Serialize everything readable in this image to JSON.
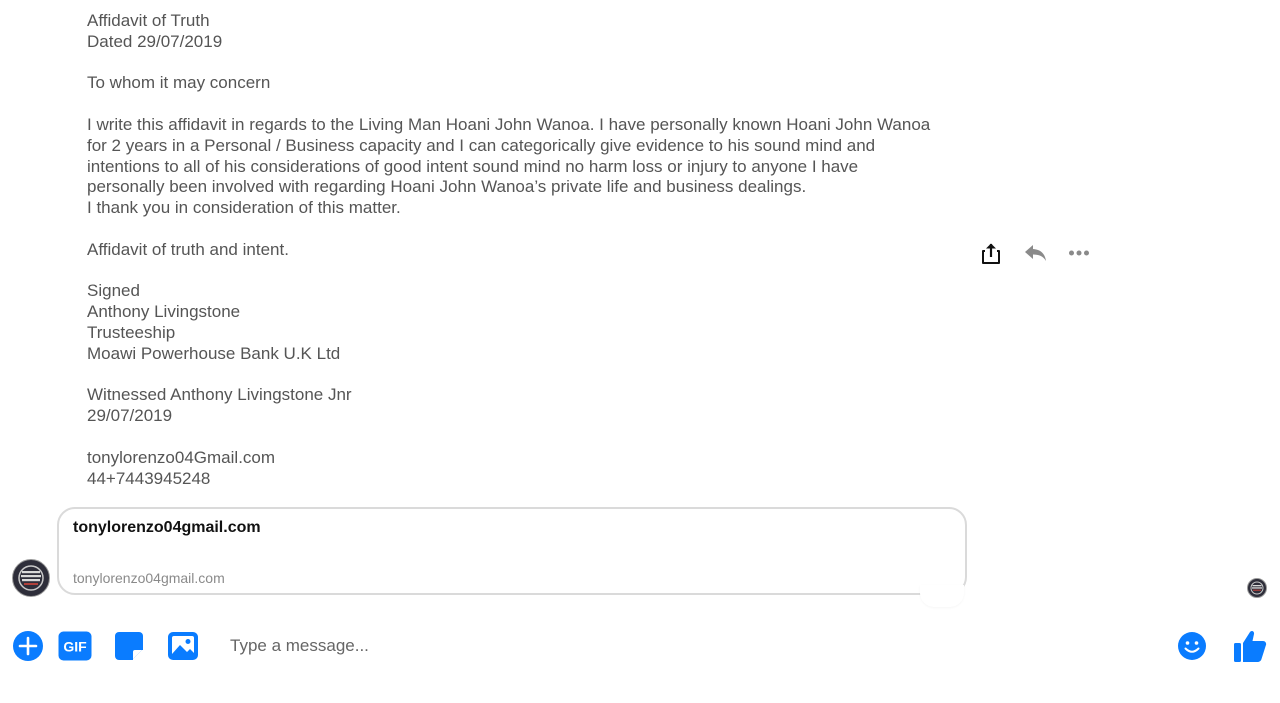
{
  "message": {
    "lines": [
      "Affidavit of Truth",
      "Dated 29/07/2019",
      "",
      "To whom it may concern",
      "",
      "I write this affidavit in regards to the Living Man Hoani John Wanoa. I have personally known Hoani John Wanoa",
      "for 2 years in a Personal / Business capacity and I can categorically give evidence to his sound mind and",
      "intentions to all of his considerations of good intent sound mind no harm loss or injury to anyone I have",
      "personally been involved with regarding Hoani John Wanoa’s private life and business dealings.",
      "I thank you in consideration of this matter.",
      "",
      "Affidavit of truth and intent.",
      "",
      "Signed",
      "Anthony Livingstone",
      "Trusteeship",
      "Moawi Powerhouse Bank U.K Ltd",
      "",
      "Witnessed Anthony Livingstone Jnr",
      "29/07/2019",
      "",
      "tonylorenzo04Gmail.com",
      "44+7443945248"
    ]
  },
  "message_actions": [
    {
      "icon": "share-icon"
    },
    {
      "icon": "reply-icon"
    },
    {
      "icon": "more-icon"
    }
  ],
  "link_preview": {
    "title": "tonylorenzo04gmail.com",
    "domain": "tonylorenzo04gmail.com"
  },
  "composer": {
    "placeholder": "Type a message...",
    "buttons": [
      {
        "icon": "plus-icon"
      },
      {
        "icon": "gif-icon",
        "label": "GIF"
      },
      {
        "icon": "sticker-icon"
      },
      {
        "icon": "image-icon"
      },
      {
        "icon": "emoji-icon"
      },
      {
        "icon": "thumbs-up-icon"
      }
    ]
  },
  "colors": {
    "accent": "#0a7cff",
    "message_text": "#555555",
    "action_icon": "#8a8a8a"
  }
}
